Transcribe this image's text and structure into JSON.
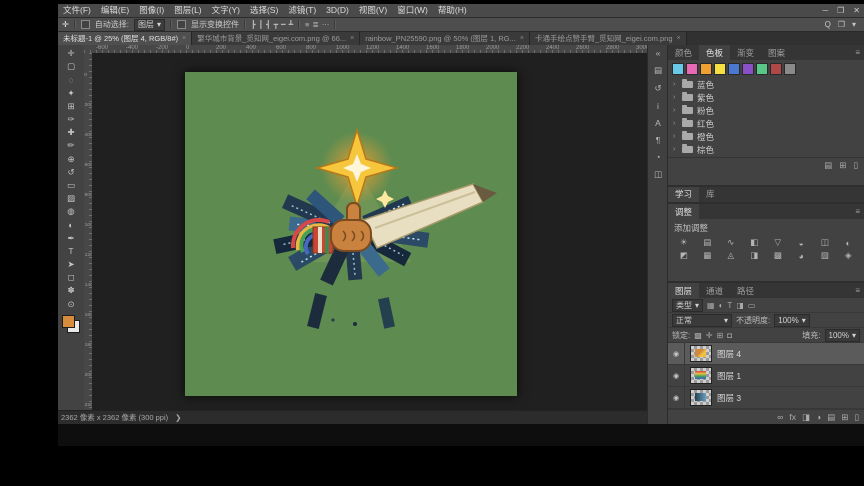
{
  "ui": {
    "caret": "▾",
    "expander": "›",
    "eye": "◉",
    "menu": "≡",
    "close_x": "×",
    "status_arrow": "❯"
  },
  "window_controls": {
    "minimize": "─",
    "maximize": "❐",
    "close": "✕"
  },
  "menubar": {
    "items": [
      "文件(F)",
      "编辑(E)",
      "图像(I)",
      "图层(L)",
      "文字(Y)",
      "选择(S)",
      "滤镜(T)",
      "3D(D)",
      "视图(V)",
      "窗口(W)",
      "帮助(H)"
    ]
  },
  "options_bar": {
    "tool_icon": "✛",
    "auto_select_label": "自动选择:",
    "auto_select_value": "图层",
    "show_transform_label": "显示变换控件",
    "align_icons": [
      "┣",
      "┃",
      "┫",
      "┳",
      "━",
      "┻"
    ],
    "distribute_icons": [
      "≡",
      "≣",
      "⋯"
    ],
    "right_icons": [
      {
        "name": "search-icon",
        "glyph": "Q"
      },
      {
        "name": "workspace-icon",
        "glyph": "❐"
      },
      {
        "name": "workspace-caret-icon",
        "glyph": "▾"
      }
    ]
  },
  "tabs": [
    {
      "label": "未标题-1 @ 25% (图层 4, RGB/8#)",
      "active": true
    },
    {
      "label": "繁华城市背景_觅知网_eigei.com.png @ 66...",
      "active": false
    },
    {
      "label": "rainbow_PN25590.png @ 50% (图层 1, RG...",
      "active": false
    },
    {
      "label": "卡通手绘点赞手臂_觅知网_eigei.com.png",
      "active": false
    }
  ],
  "ruler": {
    "h_labels": [
      "-600",
      "-400",
      "-200",
      "0",
      "200",
      "400",
      "600",
      "800",
      "1000",
      "1200",
      "1400",
      "1600",
      "1800",
      "2000",
      "2200",
      "2400",
      "2600",
      "2800",
      "3000"
    ],
    "v_labels": [
      "0",
      "200",
      "400",
      "600",
      "800",
      "1000",
      "1200",
      "1400",
      "1600",
      "1800",
      "2000",
      "2200"
    ]
  },
  "toolbar": {
    "tools": [
      {
        "name": "move-tool-icon",
        "glyph": "✛"
      },
      {
        "name": "marquee-tool-icon",
        "glyph": "▢"
      },
      {
        "name": "lasso-tool-icon",
        "glyph": "◌"
      },
      {
        "name": "quick-selection-tool-icon",
        "glyph": "✦"
      },
      {
        "name": "crop-tool-icon",
        "glyph": "⊞"
      },
      {
        "name": "eyedropper-tool-icon",
        "glyph": "✑"
      },
      {
        "name": "healing-brush-tool-icon",
        "glyph": "✚"
      },
      {
        "name": "brush-tool-icon",
        "glyph": "✏"
      },
      {
        "name": "clone-stamp-tool-icon",
        "glyph": "⊕"
      },
      {
        "name": "history-brush-tool-icon",
        "glyph": "↺"
      },
      {
        "name": "eraser-tool-icon",
        "glyph": "▭"
      },
      {
        "name": "gradient-tool-icon",
        "glyph": "▨"
      },
      {
        "name": "blur-tool-icon",
        "glyph": "◍"
      },
      {
        "name": "dodge-tool-icon",
        "glyph": "◐"
      },
      {
        "name": "pen-tool-icon",
        "glyph": "✒"
      },
      {
        "name": "type-tool-icon",
        "glyph": "T"
      },
      {
        "name": "path-selection-tool-icon",
        "glyph": "➤"
      },
      {
        "name": "shape-tool-icon",
        "glyph": "◻"
      },
      {
        "name": "hand-tool-icon",
        "glyph": "✽"
      },
      {
        "name": "zoom-tool-icon",
        "glyph": "⊙"
      }
    ],
    "foreground_color": "#d78b3c",
    "background_color": "#e8e8e8"
  },
  "canvas": {
    "background": "#5e8c50"
  },
  "illustration": {
    "star": "#f6c63c",
    "star_core": "#fff6da",
    "fist": "#c9833f",
    "sleeve": "#cc4433",
    "paper": "#e8dfc2"
  },
  "side_strip": {
    "icons": [
      {
        "name": "collapse-panels-icon",
        "glyph": "«"
      },
      {
        "name": "histogram-panel-icon",
        "glyph": "▤"
      },
      {
        "name": "history-panel-icon",
        "glyph": "↺"
      },
      {
        "name": "info-panel-icon",
        "glyph": "i"
      },
      {
        "name": "character-panel-icon",
        "glyph": "A"
      },
      {
        "name": "paragraph-panel-icon",
        "glyph": "¶"
      },
      {
        "name": "clock-panel-icon",
        "glyph": "◔"
      },
      {
        "name": "libraries-panel-icon",
        "glyph": "◫"
      }
    ]
  },
  "swatches_panel": {
    "tabs": [
      {
        "label": "颜色",
        "active": false
      },
      {
        "label": "色板",
        "active": true
      },
      {
        "label": "渐变",
        "active": false
      },
      {
        "label": "图案",
        "active": false
      }
    ],
    "recent_swatches": [
      "#68c8e8",
      "#e86ab4",
      "#f0a032",
      "#f5e042",
      "#4a78d0",
      "#8a50c8",
      "#58c888",
      "#b04848",
      "#8a8a8a"
    ],
    "groups": [
      {
        "label": "蓝色"
      },
      {
        "label": "紫色"
      },
      {
        "label": "粉色"
      },
      {
        "label": "红色"
      },
      {
        "label": "橙色"
      },
      {
        "label": "棕色"
      }
    ],
    "footer_icons": [
      {
        "name": "new-group-icon",
        "glyph": "▤"
      },
      {
        "name": "new-swatch-icon",
        "glyph": "⊞"
      },
      {
        "name": "delete-swatch-icon",
        "glyph": "▯"
      }
    ]
  },
  "learn_panel": {
    "tabs": [
      {
        "label": "学习",
        "active": true
      },
      {
        "label": "库",
        "active": false
      }
    ]
  },
  "adjustments_panel": {
    "tab": "调整",
    "header": "添加调整",
    "icons": [
      {
        "name": "brightness-contrast-icon",
        "glyph": "☀"
      },
      {
        "name": "levels-icon",
        "glyph": "▤"
      },
      {
        "name": "curves-icon",
        "glyph": "∿"
      },
      {
        "name": "exposure-icon",
        "glyph": "◧"
      },
      {
        "name": "vibrance-icon",
        "glyph": "▽"
      },
      {
        "name": "hue-saturation-icon",
        "glyph": "◒"
      },
      {
        "name": "color-balance-icon",
        "glyph": "◫"
      },
      {
        "name": "black-white-icon",
        "glyph": "◐"
      },
      {
        "name": "photo-filter-icon",
        "glyph": "◩"
      },
      {
        "name": "channel-mixer-icon",
        "glyph": "▦"
      },
      {
        "name": "color-lookup-icon",
        "glyph": "◬"
      },
      {
        "name": "invert-icon",
        "glyph": "◨"
      },
      {
        "name": "posterize-icon",
        "glyph": "▩"
      },
      {
        "name": "threshold-icon",
        "glyph": "◕"
      },
      {
        "name": "gradient-map-icon",
        "glyph": "▨"
      },
      {
        "name": "selective-color-icon",
        "glyph": "◈"
      }
    ]
  },
  "layers_panel": {
    "tabs": [
      {
        "label": "图层",
        "active": true
      },
      {
        "label": "通道",
        "active": false
      },
      {
        "label": "路径",
        "active": false
      }
    ],
    "filter_label": "类型",
    "filter_icons": [
      {
        "name": "filter-pixel-icon",
        "glyph": "▦"
      },
      {
        "name": "filter-adjustment-icon",
        "glyph": "◐"
      },
      {
        "name": "filter-type-icon",
        "glyph": "T"
      },
      {
        "name": "filter-shape-icon",
        "glyph": "◨"
      },
      {
        "name": "filter-smart-object-icon",
        "glyph": "▭"
      }
    ],
    "blend_mode": "正常",
    "opacity_label": "不透明度:",
    "opacity_value": "100%",
    "lock_label": "锁定:",
    "lock_icons": [
      {
        "name": "lock-transparency-icon",
        "glyph": "▩"
      },
      {
        "name": "lock-position-icon",
        "glyph": "✛"
      },
      {
        "name": "lock-artboard-icon",
        "glyph": "⊞"
      },
      {
        "name": "lock-all-icon",
        "glyph": "◘"
      }
    ],
    "fill_label": "填充:",
    "fill_value": "100%",
    "layers": [
      {
        "name": "图层 4",
        "selected": true,
        "thumb": "linear-gradient(135deg,#d0893f 45%,#f0c040 65%)"
      },
      {
        "name": "图层 1",
        "selected": false,
        "thumb": "linear-gradient(180deg,#d04040,#e8c040,#40a060,#4060c0)"
      },
      {
        "name": "图层 3",
        "selected": false,
        "thumb": "linear-gradient(90deg,#24404f,#69a0c0)"
      }
    ],
    "footer_icons": [
      {
        "name": "link-layers-icon",
        "glyph": "∞"
      },
      {
        "name": "layer-effects-icon",
        "glyph": "fx"
      },
      {
        "name": "layer-mask-icon",
        "glyph": "◨"
      },
      {
        "name": "adjustment-layer-icon",
        "glyph": "◑"
      },
      {
        "name": "new-group-icon",
        "glyph": "▤"
      },
      {
        "name": "new-layer-icon",
        "glyph": "⊞"
      },
      {
        "name": "delete-layer-icon",
        "glyph": "▯"
      }
    ]
  },
  "status_bar": {
    "doc_info": "2362 像素 x 2362 像素 (300 ppi)"
  }
}
